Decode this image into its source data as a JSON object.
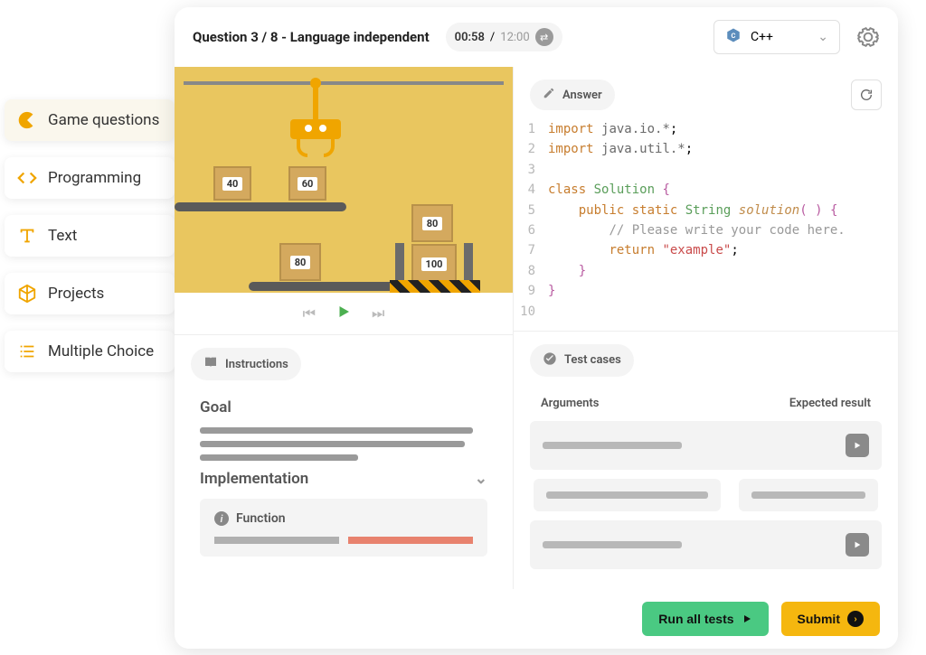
{
  "sidebar": {
    "items": [
      {
        "label": "Game questions"
      },
      {
        "label": "Programming"
      },
      {
        "label": "Text"
      },
      {
        "label": "Projects"
      },
      {
        "label": "Multiple Choice"
      }
    ]
  },
  "header": {
    "question_label": "Question 3 / 8 - Language independent",
    "timer_elapsed": "00:58",
    "timer_separator": " / ",
    "timer_total": "12:00",
    "language": "C++"
  },
  "game": {
    "boxes": [
      "40",
      "60",
      "80",
      "80",
      "100"
    ]
  },
  "answer": {
    "tab_label": "Answer",
    "lines": [
      {
        "n": "1"
      },
      {
        "n": "2"
      },
      {
        "n": "3"
      },
      {
        "n": "4"
      },
      {
        "n": "5"
      },
      {
        "n": "6"
      },
      {
        "n": "7"
      },
      {
        "n": "8"
      },
      {
        "n": "9"
      },
      {
        "n": "10"
      }
    ],
    "code": {
      "import1_kw": "import",
      "import1_pkg": "java.io.*",
      "import2_kw": "import",
      "import2_pkg": "java.util.*",
      "class_kw": "class",
      "class_name": "Solution",
      "method_kw1": "public",
      "method_kw2": "static",
      "method_ret": "String",
      "method_name": "solution",
      "comment": "// Please write your code here.",
      "return_kw": "return",
      "return_str": "\"example\""
    }
  },
  "instructions": {
    "tab_label": "Instructions",
    "goal_heading": "Goal",
    "impl_heading": "Implementation",
    "function_label": "Function"
  },
  "testcases": {
    "tab_label": "Test cases",
    "col_args": "Arguments",
    "col_expected": "Expected result"
  },
  "footer": {
    "run_label": "Run all tests",
    "submit_label": "Submit"
  }
}
